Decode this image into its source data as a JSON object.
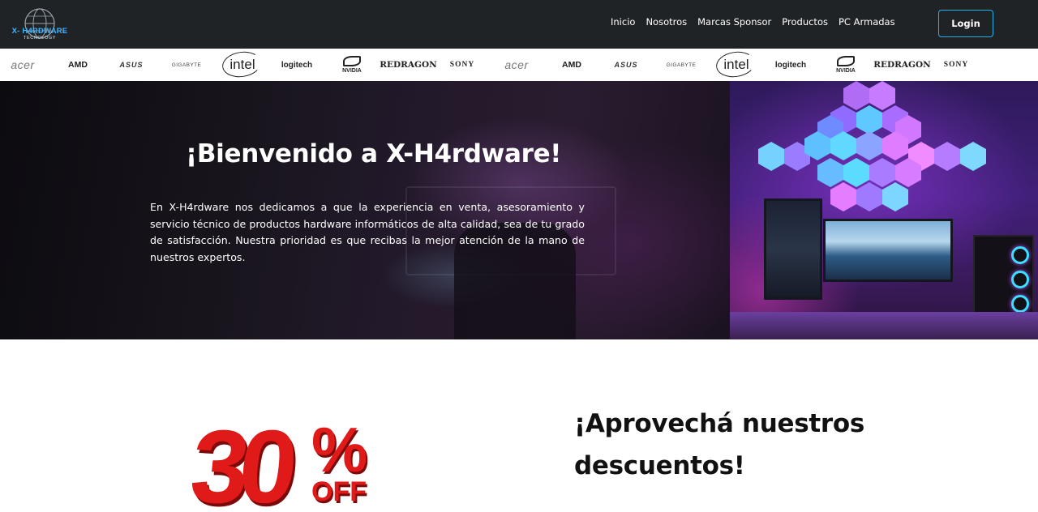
{
  "brand": {
    "name": "X- H4RDWARE",
    "tagline": "TECNOLOGY",
    "accent_color": "#27b1e8"
  },
  "nav": {
    "links": [
      "Inicio",
      "Nosotros",
      "Marcas Sponsor",
      "Productos",
      "PC Armadas"
    ],
    "login_label": "Login"
  },
  "sponsors": {
    "labels": [
      "acer",
      "AMD",
      "ASUS",
      "GIGABYTE",
      "intel",
      "logitech",
      "NVIDIA",
      "REDRAGON",
      "SONY"
    ]
  },
  "hero": {
    "title": "¡Bienvenido a X-H4rdware!",
    "text": "En X-H4rdware nos dedicamos a que la experiencia en venta, asesoramiento y servicio técnico de productos hardware informáticos de alta calidad, sea de tu grado de satisfacción. Nuestra prioridad es que recibas la mejor atención de la mano de nuestros expertos."
  },
  "promo": {
    "discount_number": "30",
    "discount_symbol": "%",
    "discount_suffix": "OFF",
    "badge_color": "#e01919",
    "title": "¡Aprovechá nuestros descuentos!"
  }
}
